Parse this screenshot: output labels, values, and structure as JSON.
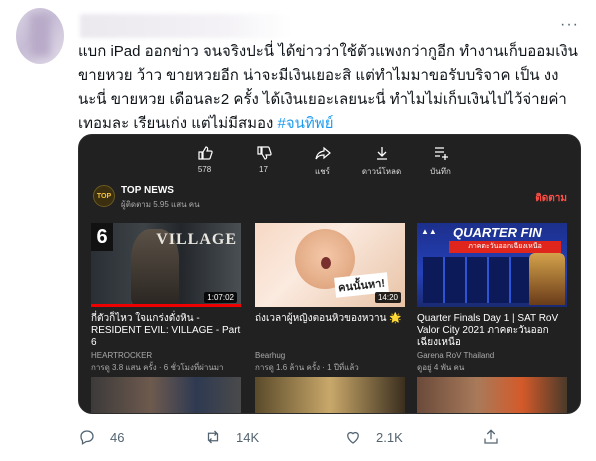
{
  "tweet": {
    "text_main": "แบก iPad ออกข่าว จนจริงปะนี่ ได้ข่าวว่าใช้ตัวแพงกว่ากูอีก ทำงานเก็บออมเงิน ขายหวย ว้าว ขายหวยอีก น่าจะมีเงินเยอะสิ แต่ทำไมมาขอรับบริจาค เป็น งง นะนี่ ขายหวย เดือนละ2 ครั้ง ได้เงินเยอะเลยนะนี่ ทำไมไม่เก็บเงินไปไว้จ่ายค่าเทอมละ เรียนเก่ง แต่ไม่มีสมอง ",
    "hashtag": "#จนทิพย์",
    "more_label": "···"
  },
  "embed": {
    "actions": [
      {
        "icon": "like-icon",
        "label": "578"
      },
      {
        "icon": "dislike-icon",
        "label": "17"
      },
      {
        "icon": "share-icon",
        "label": "แชร์"
      },
      {
        "icon": "download-icon",
        "label": "ดาวน์โหลด"
      },
      {
        "icon": "save-icon",
        "label": "บันทึก"
      }
    ],
    "channel": {
      "name": "TOP NEWS",
      "subs": "ผู้ติดตาม 5.95 แสน คน",
      "follow_label": "ติดตาม",
      "logo_text": "TOP"
    },
    "videos": [
      {
        "title": "กี่ตัวก็ไหว ใจแกร่งดั่งหิน - RESIDENT EVIL: VILLAGE - Part 6",
        "author": "HEARTROCKER",
        "meta": "การดู 3.8 แสน ครั้ง · 6 ชั่วโมงที่ผ่านมา",
        "duration": "1:07:02",
        "thumb_text": "VILLAGE",
        "thumb_num": "6"
      },
      {
        "title": "ถ่งเวลาผู้หญิงตอนหิวของหวาน 🌟",
        "author": "Bearhug",
        "meta": "การดู 1.6 ล้าน ครั้ง · 1 ปีที่แล้ว",
        "duration": "14:20",
        "thumb_text": "คนนั้นหา!"
      },
      {
        "title": "Quarter Finals Day 1 | SAT RoV Valor City 2021 ภาคตะวันออกเฉียงเหนือ",
        "author": "Garena RoV Thailand",
        "meta": "ดูอยู่ 4 พัน คน",
        "thumb_text": "QUARTER FIN",
        "thumb_sub": "ภาคตะวันออกเฉียงเหนือ"
      }
    ]
  },
  "footer": {
    "reply": "46",
    "retweet": "14K",
    "like": "2.1K"
  }
}
